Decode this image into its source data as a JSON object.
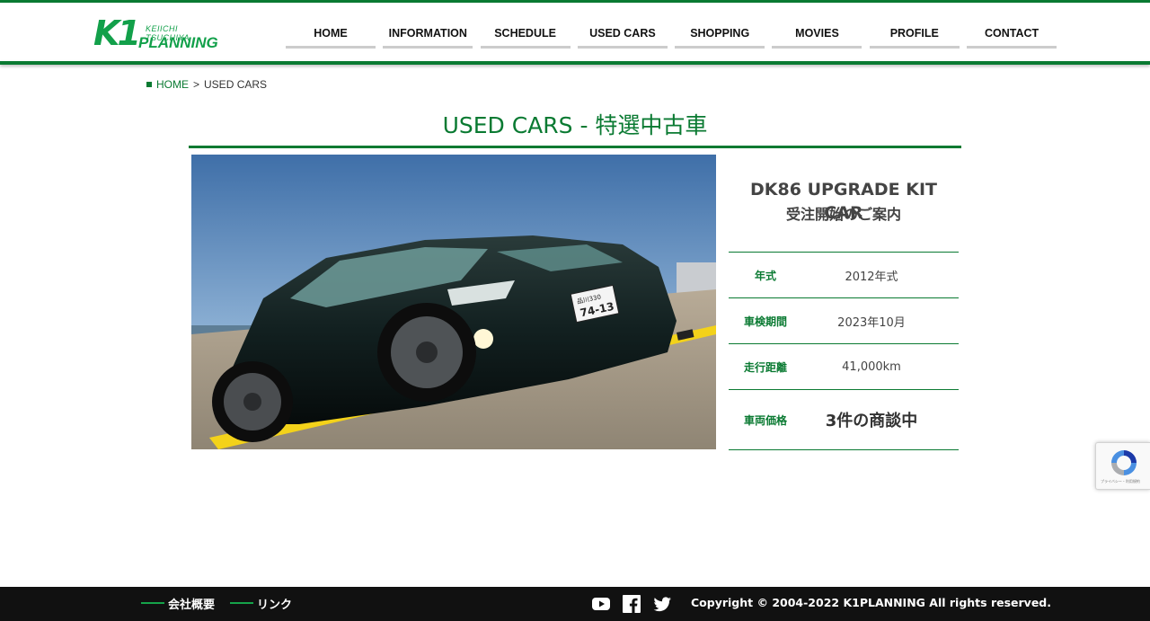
{
  "brand": {
    "logo_big": "K1",
    "logo_small": "KEIICHI TSUCHIYA",
    "logo_plan": "PLANNING",
    "accent_color": "#0a7a32"
  },
  "nav": {
    "items": [
      {
        "label": "HOME"
      },
      {
        "label": "INFORMATION"
      },
      {
        "label": "SCHEDULE"
      },
      {
        "label": "USED CARS"
      },
      {
        "label": "SHOPPING"
      },
      {
        "label": "MOVIES"
      },
      {
        "label": "PROFILE"
      },
      {
        "label": "CONTACT"
      }
    ]
  },
  "breadcrumb": {
    "home": "HOME",
    "sep": ">",
    "current": "USED CARS"
  },
  "page": {
    "title": "USED CARS - 特選中古車"
  },
  "car": {
    "plate_top": "品川330",
    "plate_number": "74-13",
    "name": "DK86 UPGRADE KIT CAR",
    "subtitle": "受注開始のご案内",
    "specs": [
      {
        "key": "年式",
        "value": "2012年式"
      },
      {
        "key": "車検期間",
        "value": "2023年10月"
      },
      {
        "key": "走行距離",
        "value": "41,000km"
      },
      {
        "key": "車両価格",
        "value": "3件の商談中"
      }
    ]
  },
  "recaptcha": {
    "text": "プライバシー・利用規約"
  },
  "footer": {
    "links": [
      {
        "label": "会社概要"
      },
      {
        "label": "リンク"
      }
    ],
    "social": [
      "youtube-icon",
      "facebook-icon",
      "twitter-icon"
    ],
    "copyright": "Copyright © 2004-2022 K1PLANNING All rights reserved."
  }
}
